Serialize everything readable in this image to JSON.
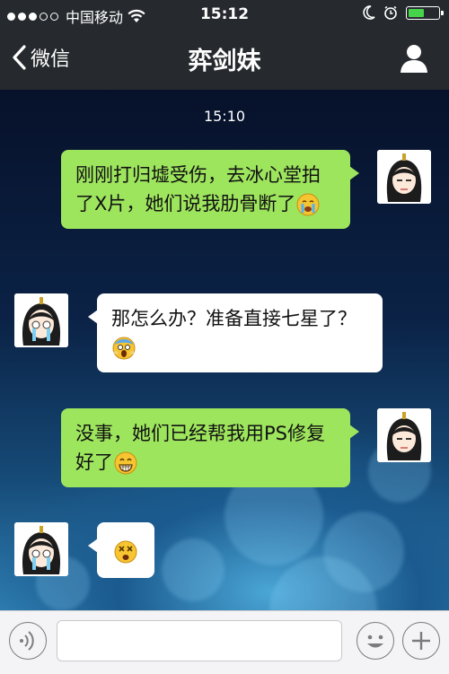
{
  "status_bar": {
    "carrier": "中国移动",
    "time": "15:12",
    "battery_level": 0.55,
    "battery_color": "#46d54a"
  },
  "nav": {
    "back_label": "微信",
    "title": "弈剑妹",
    "profile_icon": "person-icon"
  },
  "chat": {
    "timestamp": "15:10",
    "messages": [
      {
        "side": "right",
        "text": "刚刚打归墟受伤，去冰心堂拍了X片，她们说我肋骨断了",
        "emoji": "crying-face"
      },
      {
        "side": "left",
        "text": "那怎么办？准备直接七星了？",
        "emoji": "screaming-face"
      },
      {
        "side": "right",
        "text": "没事，她们已经帮我用PS修复好了",
        "emoji": "grinning-face"
      },
      {
        "side": "left",
        "text": "",
        "emoji": "dizzy-face"
      }
    ]
  },
  "input_bar": {
    "voice_icon": "voice-icon",
    "emoji_icon": "smiley-icon",
    "more_icon": "plus-icon"
  },
  "colors": {
    "sent_bubble": "#9ee55e",
    "received_bubble": "#ffffff",
    "nav_bg": "#262a2e"
  }
}
